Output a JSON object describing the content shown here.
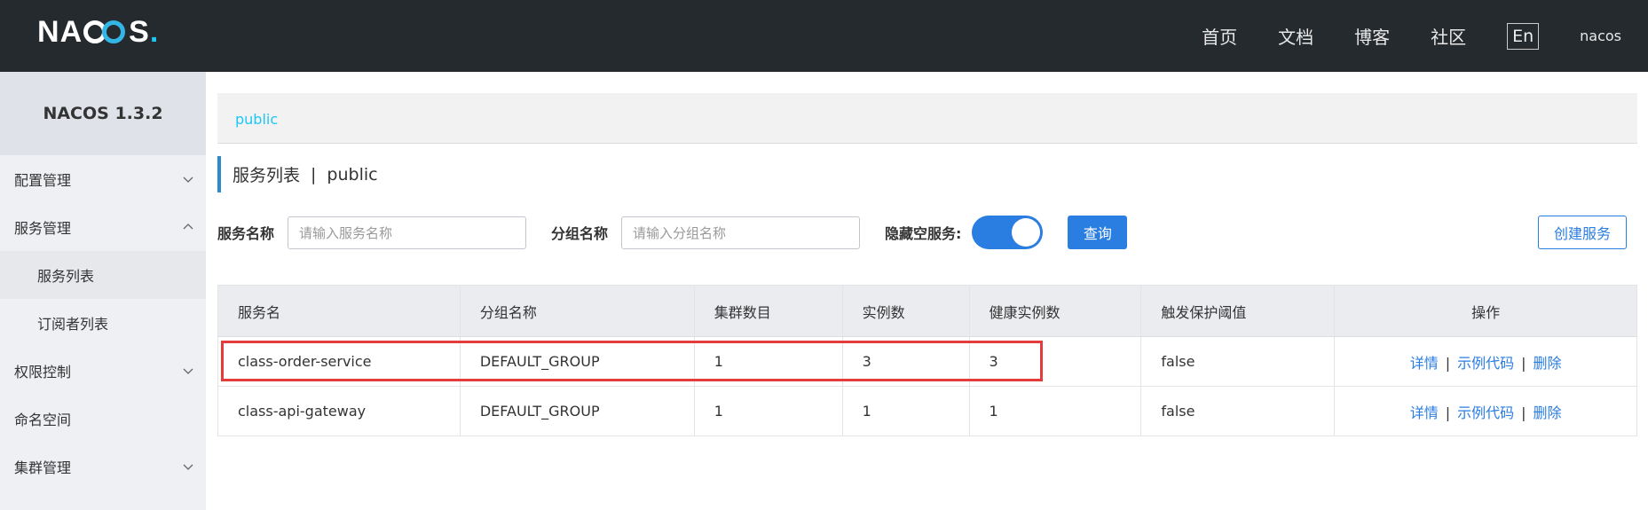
{
  "header": {
    "logo_text": "NACOS",
    "nav": [
      "首页",
      "文档",
      "博客",
      "社区"
    ],
    "lang": "En",
    "user": "nacos"
  },
  "sidebar": {
    "version": "NACOS 1.3.2",
    "items": [
      {
        "label": "配置管理",
        "chevron": "down"
      },
      {
        "label": "服务管理",
        "chevron": "up"
      },
      {
        "label": "服务列表",
        "sub": true,
        "active": true
      },
      {
        "label": "订阅者列表",
        "sub": true
      },
      {
        "label": "权限控制",
        "chevron": "down"
      },
      {
        "label": "命名空间"
      },
      {
        "label": "集群管理",
        "chevron": "down"
      }
    ]
  },
  "namespace_bar": {
    "selected": "public"
  },
  "page": {
    "title": "服务列表",
    "separator": "|",
    "namespace": "public"
  },
  "filters": {
    "service_label": "服务名称",
    "service_placeholder": "请输入服务名称",
    "group_label": "分组名称",
    "group_placeholder": "请输入分组名称",
    "hide_empty_label": "隐藏空服务:",
    "hide_empty_on": true,
    "query_button": "查询",
    "create_button": "创建服务"
  },
  "table": {
    "columns": [
      "服务名",
      "分组名称",
      "集群数目",
      "实例数",
      "健康实例数",
      "触发保护阈值",
      "操作"
    ],
    "rows": [
      {
        "name": "class-order-service",
        "group": "DEFAULT_GROUP",
        "clusters": "1",
        "instances": "3",
        "healthy": "3",
        "threshold": "false"
      },
      {
        "name": "class-api-gateway",
        "group": "DEFAULT_GROUP",
        "clusters": "1",
        "instances": "1",
        "healthy": "1",
        "threshold": "false"
      }
    ],
    "actions": {
      "detail": "详情",
      "sample": "示例代码",
      "delete": "删除",
      "sep": "|"
    }
  },
  "colors": {
    "accent": "#2a7de1",
    "topbar": "#252a2f",
    "highlight": "#e43b3b",
    "namespace": "#1dc7f5"
  }
}
